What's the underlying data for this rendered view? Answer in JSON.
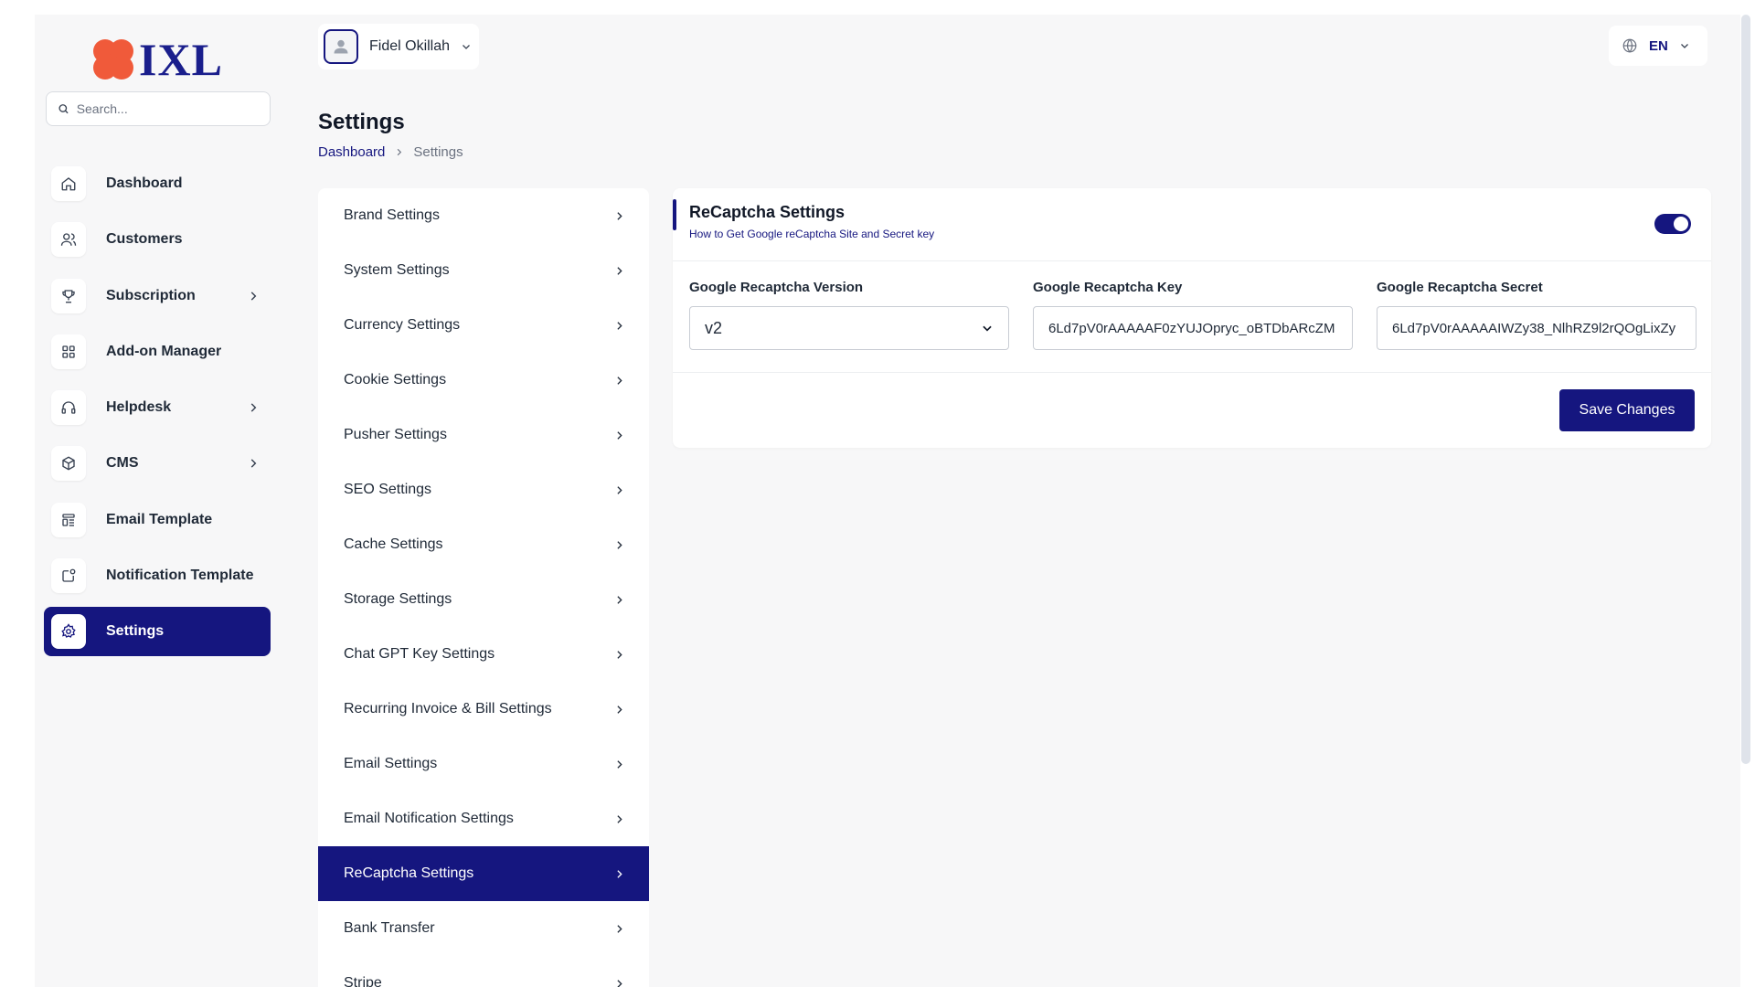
{
  "brand": {
    "logo_text": "IXL",
    "accent": "#15167f",
    "logo_color": "#f05a3a"
  },
  "search": {
    "placeholder": "Search..."
  },
  "sidebar": {
    "items": [
      {
        "label": "Dashboard",
        "icon": "home-icon",
        "chevron": false
      },
      {
        "label": "Customers",
        "icon": "users-icon",
        "chevron": false
      },
      {
        "label": "Subscription",
        "icon": "trophy-icon",
        "chevron": true
      },
      {
        "label": "Add-on Manager",
        "icon": "grid-icon",
        "chevron": false
      },
      {
        "label": "Helpdesk",
        "icon": "headphones-icon",
        "chevron": true
      },
      {
        "label": "CMS",
        "icon": "box-icon",
        "chevron": true
      },
      {
        "label": "Email Template",
        "icon": "template-icon",
        "chevron": false
      },
      {
        "label": "Notification Template",
        "icon": "notification-icon",
        "chevron": false
      },
      {
        "label": "Settings",
        "icon": "gear-icon",
        "chevron": false,
        "active": true
      }
    ]
  },
  "header": {
    "user_name": "Fidel Okillah",
    "language": "EN"
  },
  "page": {
    "title": "Settings",
    "breadcrumb": {
      "home": "Dashboard",
      "current": "Settings"
    }
  },
  "settings_menu": [
    "Brand Settings",
    "System Settings",
    "Currency Settings",
    "Cookie Settings",
    "Pusher Settings",
    "SEO Settings",
    "Cache Settings",
    "Storage Settings",
    "Chat GPT Key Settings",
    "Recurring Invoice & Bill Settings",
    "Email Settings",
    "Email Notification Settings",
    "ReCaptcha Settings",
    "Bank Transfer",
    "Stripe"
  ],
  "settings_menu_active": "ReCaptcha Settings",
  "recaptcha": {
    "title": "ReCaptcha Settings",
    "help_link": "How to Get Google reCaptcha Site and Secret key",
    "enabled": true,
    "version_label": "Google Recaptcha Version",
    "version_value": "v2",
    "key_label": "Google Recaptcha Key",
    "key_value": "6Ld7pV0rAAAAAF0zYUJOpryc_oBTDbARcZM",
    "secret_label": "Google Recaptcha Secret",
    "secret_value": "6Ld7pV0rAAAAAIWZy38_NlhRZ9l2rQOgLixZy",
    "save_label": "Save Changes"
  }
}
